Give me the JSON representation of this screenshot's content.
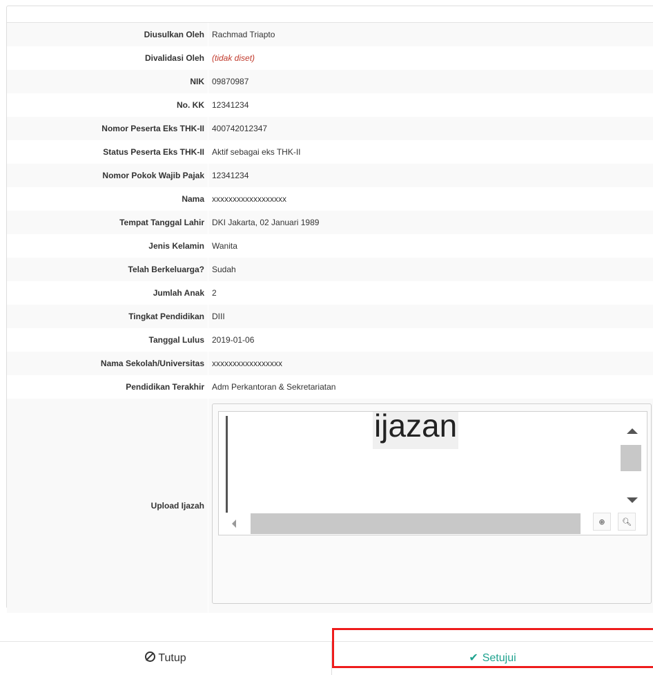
{
  "rows": [
    {
      "label": "Diusulkan Oleh",
      "value": "Rachmad Triapto"
    },
    {
      "label": "Divalidasi Oleh",
      "value": "(tidak diset)"
    },
    {
      "label": "NIK",
      "value": "09870987"
    },
    {
      "label": "No. KK",
      "value": "12341234"
    },
    {
      "label": "Nomor Peserta Eks THK-II",
      "value": "400742012347"
    },
    {
      "label": "Status Peserta Eks THK-II",
      "value": "Aktif sebagai eks THK-II"
    },
    {
      "label": "Nomor Pokok Wajib Pajak",
      "value": "12341234"
    },
    {
      "label": "Nama",
      "value": "xxxxxxxxxxxxxxxxxx"
    },
    {
      "label": "Tempat Tanggal Lahir",
      "value": "DKI Jakarta, 02 Januari 1989"
    },
    {
      "label": "Jenis Kelamin",
      "value": "Wanita"
    },
    {
      "label": "Telah Berkeluarga?",
      "value": "Sudah"
    },
    {
      "label": "Jumlah Anak",
      "value": "2"
    },
    {
      "label": "Tingkat Pendidikan",
      "value": "DIII"
    },
    {
      "label": "Tanggal Lulus",
      "value": "2019-01-06"
    },
    {
      "label": "Nama Sekolah/Universitas",
      "value": "xxxxxxxxxxxxxxxxx"
    },
    {
      "label": "Pendidikan Terakhir",
      "value": "Adm Perkantoran & Sekretariatan"
    }
  ],
  "upload": {
    "label": "Upload Ijazah",
    "document_text": "ijazan"
  },
  "footer": {
    "close_label": "Tutup",
    "approve_label": "Setujui"
  },
  "colors": {
    "not_set": "#c0392b",
    "approve": "#1fa38f",
    "highlight": "#ee1c1c"
  },
  "icons": {
    "close": "ban-icon",
    "approve": "check-icon",
    "viewer_tools": [
      "download-icon",
      "zoom-in-icon"
    ]
  }
}
